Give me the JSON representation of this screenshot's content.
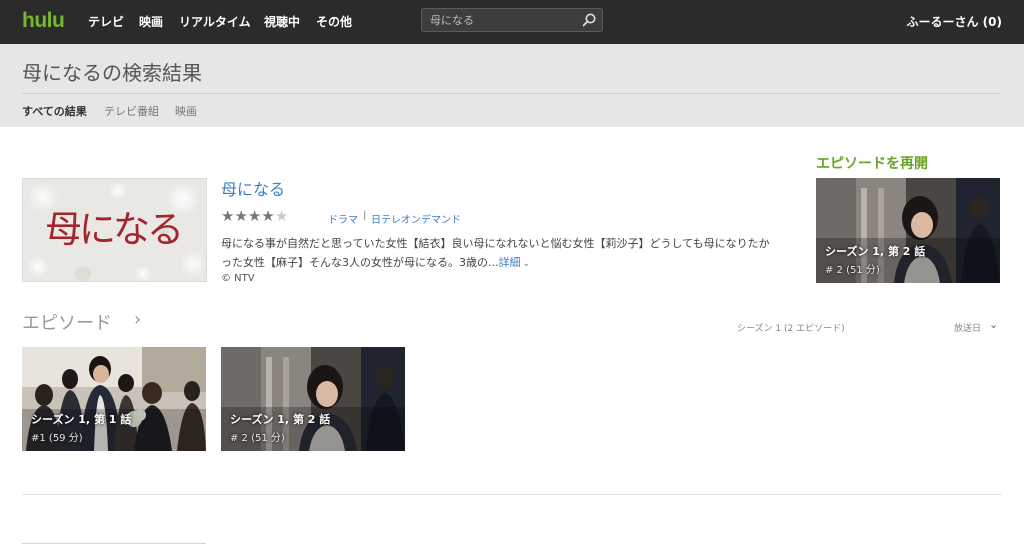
{
  "nav": {
    "logo": "hulu",
    "items": [
      {
        "label": "テレビ"
      },
      {
        "label": "映画"
      },
      {
        "label": "リアルタイム"
      },
      {
        "label": "視聴中"
      },
      {
        "label": "その他"
      }
    ],
    "search_placeholder": "母になる",
    "user_label": "ふーるーさん (0)"
  },
  "results": {
    "title": "母になるの検索結果",
    "filters": [
      {
        "label": "すべての結果",
        "active": true
      },
      {
        "label": "テレビ番組",
        "active": false
      },
      {
        "label": "映画",
        "active": false
      }
    ]
  },
  "show": {
    "thumb_text": "母になる",
    "title": "母になる",
    "rating": 4,
    "rating_max": 5,
    "genre": "ドラマ",
    "network": "日テレオンデマンド",
    "description_line1": "母になる事が自然だと思っていた女性【結衣】良い母になれないと悩む女性【莉沙子】どうしても母になりたか",
    "description_line2": "った女性【麻子】そんな3人の女性が母になる。3歳の...",
    "more_label": "詳細",
    "copyright": "© NTV"
  },
  "resume": {
    "heading": "エピソードを再開",
    "episode_title": "シーズン 1, 第 2 話",
    "episode_sub": "# 2 (51 分)"
  },
  "episodes": {
    "heading": "エピソード",
    "count_label": "シーズン 1 (2 エピソード)",
    "sort_label": "放送日",
    "items": [
      {
        "title": "シーズン 1, 第 1 話",
        "sub": "#1 (59 分)"
      },
      {
        "title": "シーズン 1, 第 2 話",
        "sub": "# 2 (51 分)"
      }
    ]
  },
  "colors": {
    "brand": "#76b82a",
    "link": "#3c7ec4",
    "topbar": "#2b2b2b"
  }
}
